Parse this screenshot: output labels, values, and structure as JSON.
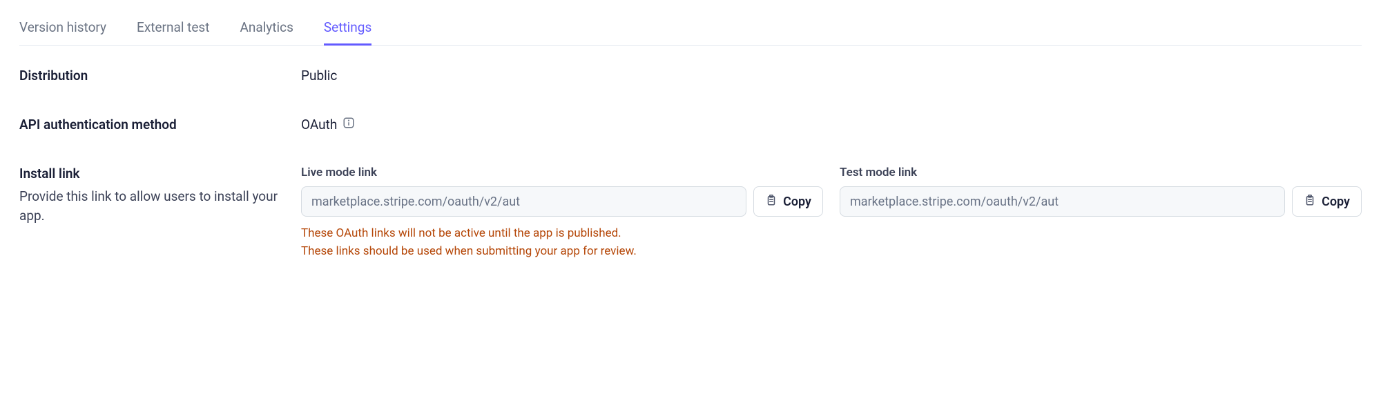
{
  "tabs": [
    {
      "label": "Version history",
      "active": false
    },
    {
      "label": "External test",
      "active": false
    },
    {
      "label": "Analytics",
      "active": false
    },
    {
      "label": "Settings",
      "active": true
    }
  ],
  "settings": {
    "distribution": {
      "label": "Distribution",
      "value": "Public"
    },
    "auth_method": {
      "label": "API authentication method",
      "value": "OAuth"
    },
    "install_link": {
      "label": "Install link",
      "description": "Provide this link to allow users to install your app.",
      "live_mode": {
        "label": "Live mode link",
        "value": "marketplace.stripe.com/oauth/v2/aut"
      },
      "test_mode": {
        "label": "Test mode link",
        "value": "marketplace.stripe.com/oauth/v2/aut"
      },
      "copy_button_label": "Copy",
      "warning_line1": "These OAuth links will not be active until the app is published.",
      "warning_line2": "These links should be used when submitting your app for review."
    }
  }
}
